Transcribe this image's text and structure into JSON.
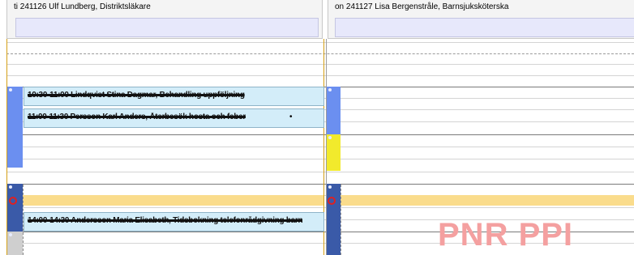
{
  "columns": [
    {
      "header": "ti 241126 Ulf Lundberg, Distriktsläkare"
    },
    {
      "header": "on 241127 Lisa Bergenstråle, Barnsjuksköterska"
    }
  ],
  "appointments": [
    {
      "text": "10:30-11:00 Lindqvist Stina Dagmar, Behandling uppföljning"
    },
    {
      "text": "11:00-11:30 Persson Karl Anders, Återbesök hosta och feber"
    },
    {
      "text": "14:00-14:30 Andersson Maria Elisabeth, Tidsbokning telefonrådgivning barn"
    }
  ],
  "bullet": "•",
  "watermark": "PNR PPI",
  "colors": {
    "blue_slot": "#6b8ff0",
    "dark_slot": "#3a5aa8",
    "yellow_slot": "#f2ea2c",
    "grey_slot": "#cfcfcf",
    "highlight": "#fadc8c",
    "appointment_bg": "#d3edf9",
    "header_box": "#e7e8fb",
    "marker": "#e02020"
  }
}
